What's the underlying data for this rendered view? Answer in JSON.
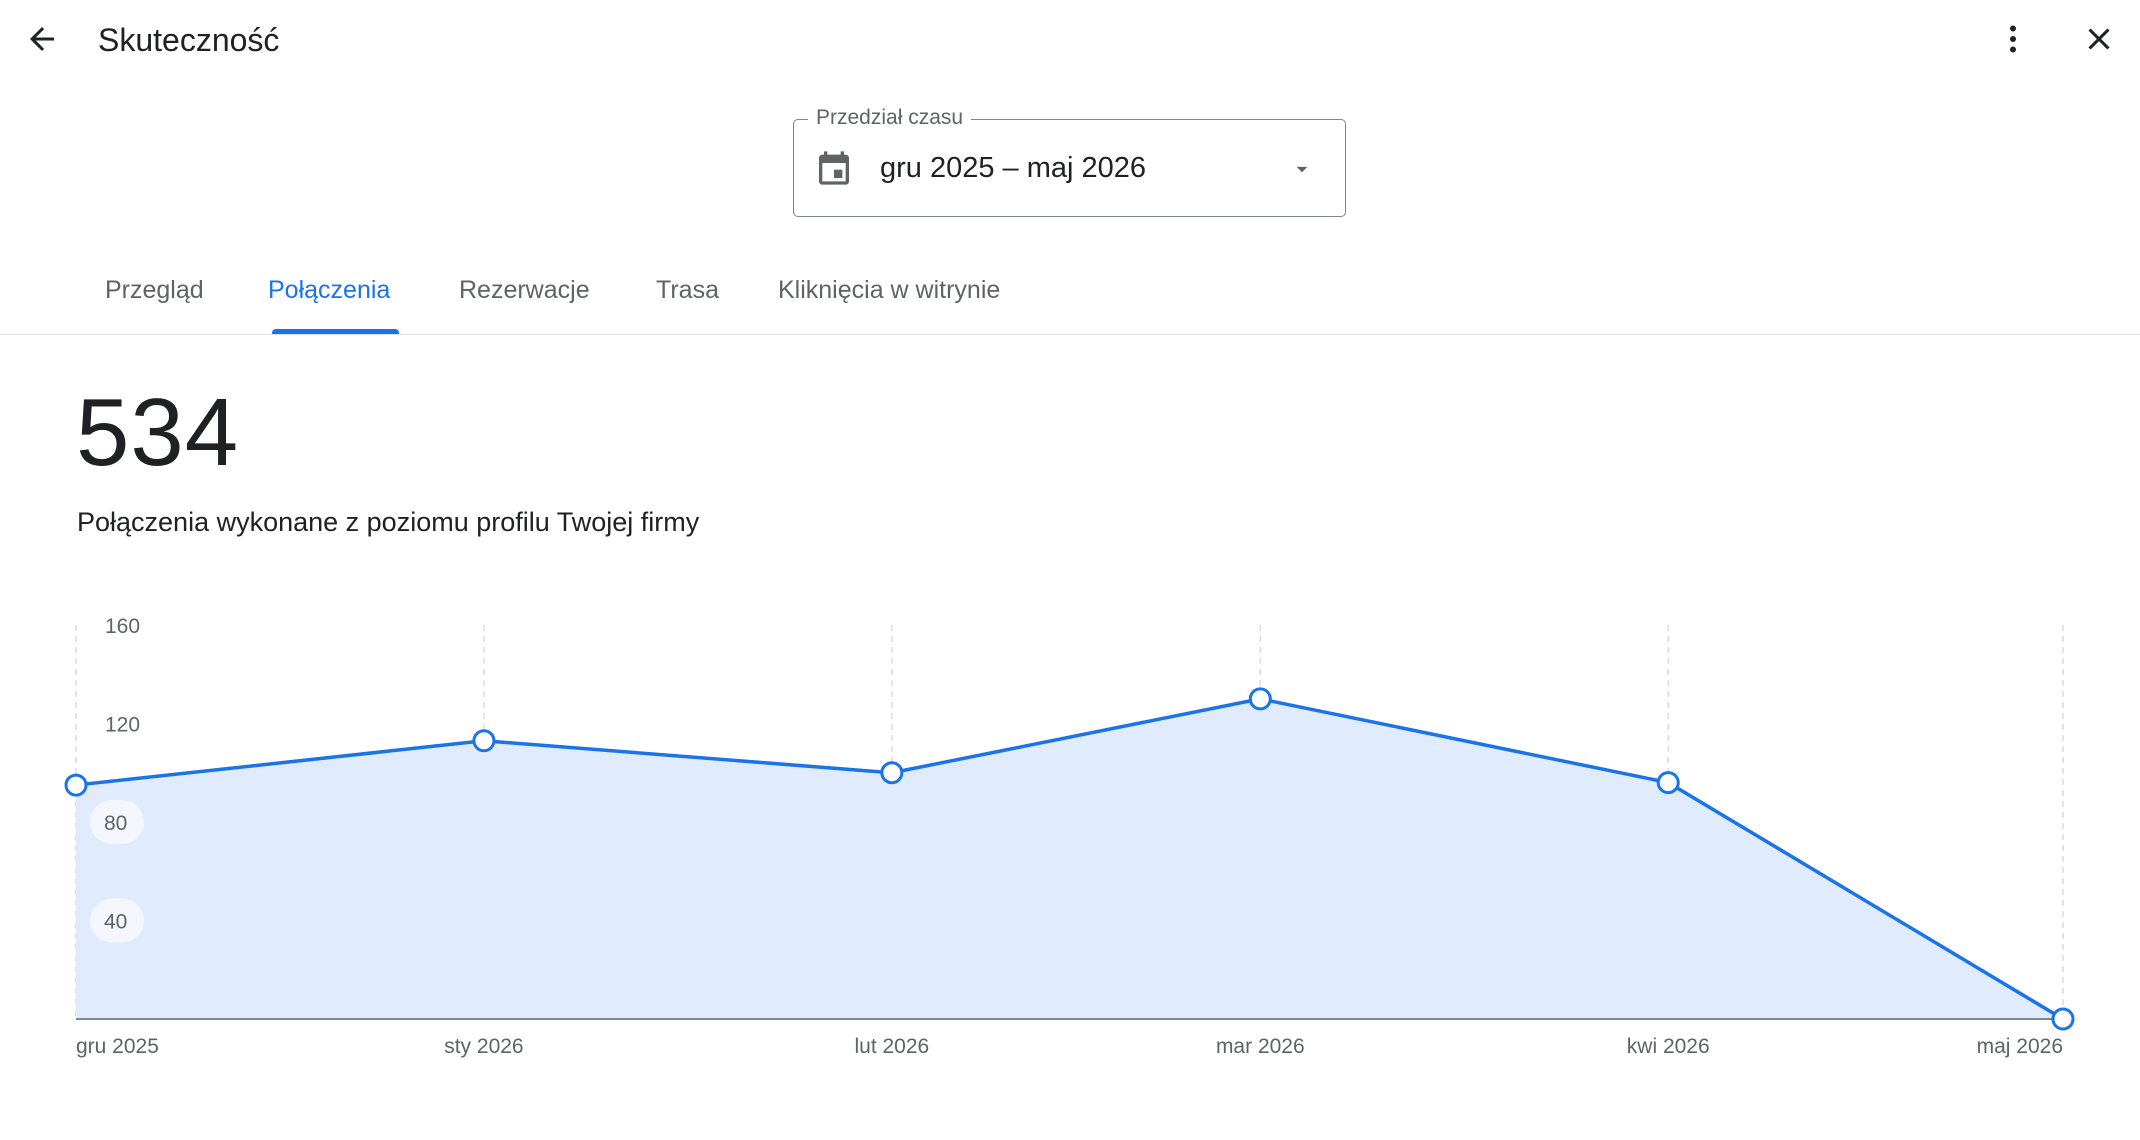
{
  "header": {
    "title": "Skuteczność",
    "back_icon": "arrow-back-icon",
    "more_icon": "more-vert-icon",
    "close_icon": "close-icon"
  },
  "date_range": {
    "label": "Przedział czasu",
    "value": "gru 2025 – maj 2026",
    "icon": "calendar-icon"
  },
  "tabs": [
    {
      "label": "Przegląd",
      "active": false
    },
    {
      "label": "Połączenia",
      "active": true
    },
    {
      "label": "Rezerwacje",
      "active": false
    },
    {
      "label": "Trasa",
      "active": false
    },
    {
      "label": "Kliknięcia w witrynie",
      "active": false
    }
  ],
  "summary": {
    "total": "534",
    "description": "Połączenia wykonane z poziomu profilu Twojej firmy"
  },
  "colors": {
    "accent": "#1a73e8",
    "area_fill": "#e0ebfd",
    "text_primary": "#202124",
    "text_secondary": "#5f6368"
  },
  "chart_data": {
    "type": "area",
    "categories": [
      "gru 2025",
      "sty 2026",
      "lut 2026",
      "mar 2026",
      "kwi 2026",
      "maj 2026"
    ],
    "values": [
      95,
      113,
      100,
      130,
      96,
      0
    ],
    "ylim": [
      0,
      160
    ],
    "yticks": [
      40,
      80,
      120,
      160
    ],
    "grid": "vertical-dashed"
  }
}
